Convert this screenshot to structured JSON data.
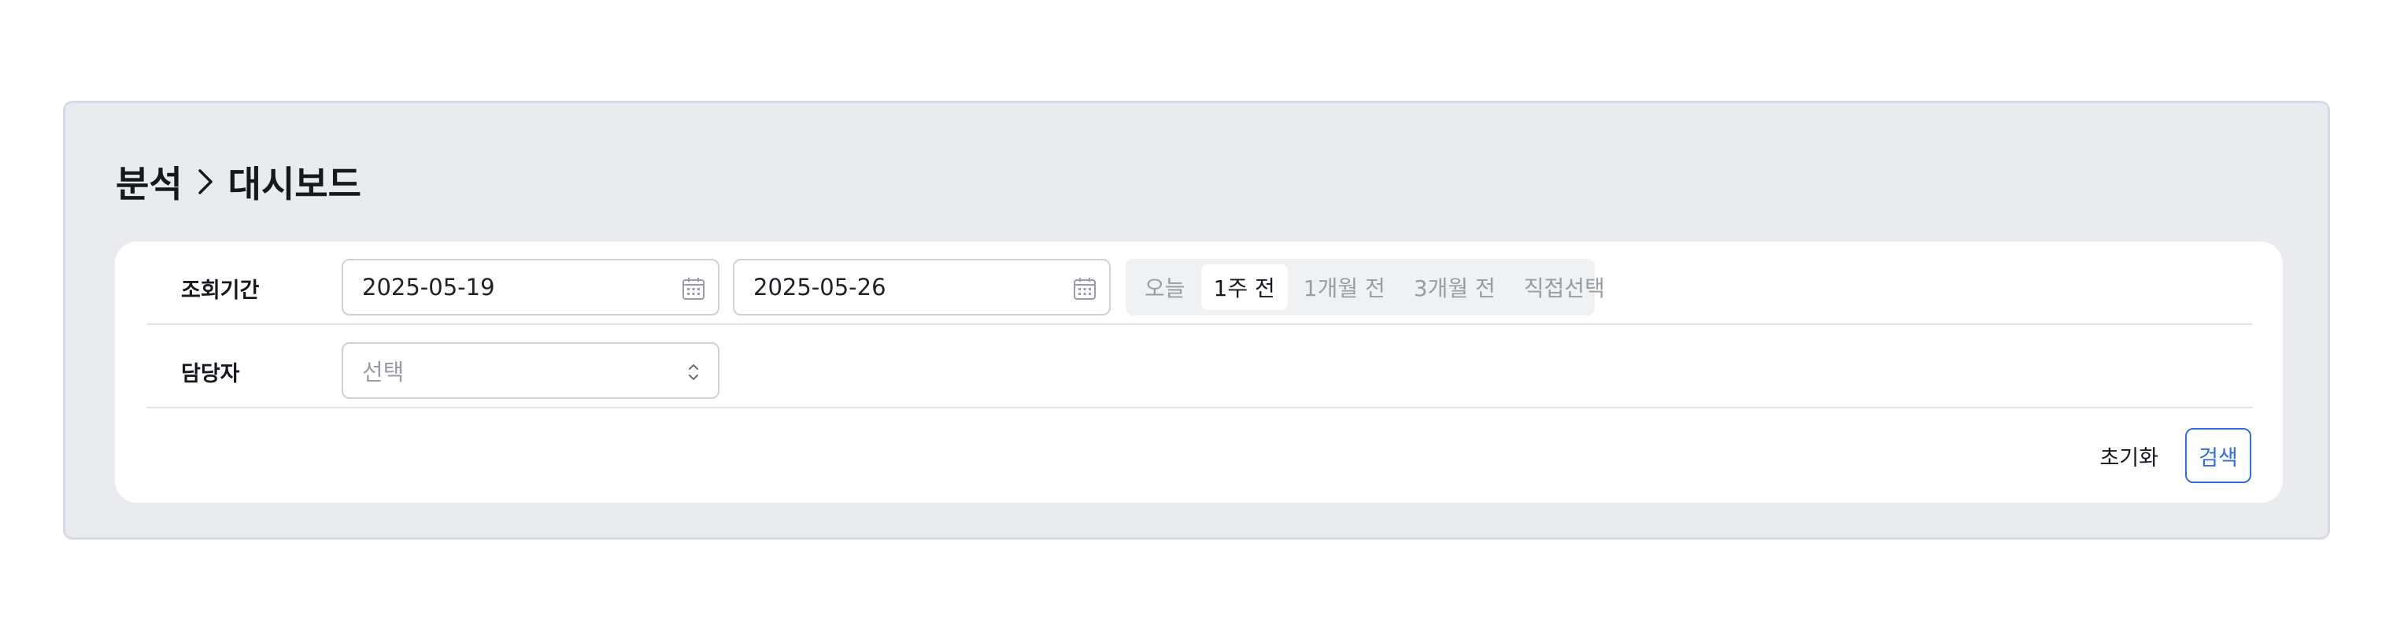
{
  "breadcrumb": {
    "section": "분석",
    "page": "대시보드"
  },
  "filters": {
    "period_label": "조회기간",
    "start_date": "2025-05-19",
    "end_date": "2025-05-26",
    "quick_ranges": [
      {
        "label": "오늘",
        "active": false
      },
      {
        "label": "1주 전",
        "active": true
      },
      {
        "label": "1개월 전",
        "active": false
      },
      {
        "label": "3개월 전",
        "active": false
      },
      {
        "label": "직접선택",
        "active": false
      }
    ],
    "assignee_label": "담당자",
    "assignee_placeholder": "선택"
  },
  "actions": {
    "reset_label": "초기화",
    "search_label": "검색"
  },
  "icons": {
    "date": "calendar-icon",
    "select": "up-down-chevron-icon",
    "breadcrumb": "chevron-right-icon"
  },
  "colors": {
    "accent": "#2f6fde",
    "panel_bg": "#eaebee"
  }
}
